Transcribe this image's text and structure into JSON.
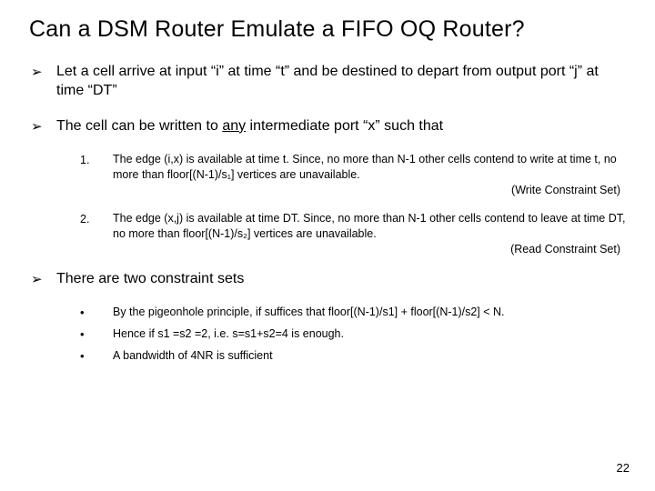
{
  "title": "Can a DSM Router Emulate a FIFO OQ Router?",
  "bullets": {
    "b1": "Let a cell arrive at input “i” at time “t” and be destined to depart from output port “j” at time “DT”",
    "b2_pre": "The cell can be written to ",
    "b2_any": "any",
    "b2_post": " intermediate port “x” such that",
    "b3": "There are two constraint sets"
  },
  "num": {
    "n1": {
      "marker": "1.",
      "text": "The edge (i,x) is available at time t. Since, no more than N-1 other cells contend to write at time t, no more than floor[(N-1)/s₁] vertices are unavailable.",
      "note": "(Write Constraint Set)"
    },
    "n2": {
      "marker": "2.",
      "text": "The edge (x,j) is available at time DT. Since, no more than N-1 other cells contend to leave at time DT, no more than floor[(N-1)/s₂] vertices are unavailable.",
      "note": "(Read Constraint Set)"
    }
  },
  "dots": {
    "d1": "By the pigeonhole principle, if suffices that floor[(N-1)/s1] + floor[(N-1)/s2] < N.",
    "d2": "Hence if s1 =s2 =2, i.e. s=s1+s2=4 is enough.",
    "d3": "A bandwidth of 4NR is sufficient"
  },
  "arrow": "➢",
  "dot": "•",
  "pagenum": "22"
}
